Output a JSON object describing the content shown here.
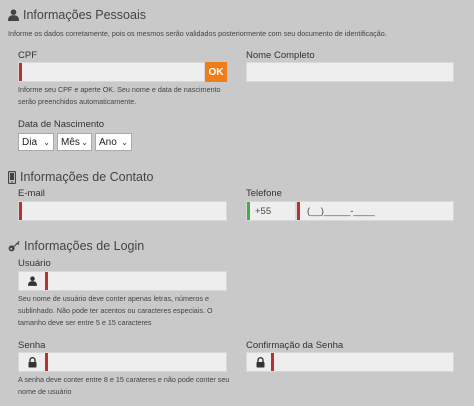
{
  "personal": {
    "title": "Informações Pessoais",
    "notice": "Informe os dados corretamente, pois os mesmos serão validados posteriormente com seu documento de identificação.",
    "cpf_label": "CPF",
    "ok_label": "OK",
    "cpf_hint": "Informe seu CPF e aperte OK. Seu nome e data de nascimento serão preenchidos automaticamente.",
    "name_label": "Nome Completo",
    "birth_label": "Data de Nascimento",
    "day_option": "Dia",
    "month_option": "Mês",
    "year_option": "Ano"
  },
  "contact": {
    "title": "Informações de Contato",
    "email_label": "E-mail",
    "phone_label": "Telefone",
    "country_code": "+55",
    "phone_mask": "(__)_____-____"
  },
  "login": {
    "title": "Informações de Login",
    "user_label": "Usuário",
    "user_hint": "Seu nome de usuário deve conter apenas letras, números e sublinhado. Não pode ter acentos ou caracteres especiais. O tamanho deve ser entre 5 e 15 caracteres",
    "password_label": "Senha",
    "confirm_label": "Confirmação da Senha",
    "password_hint": "A senha deve conter entre 8 e 15 carateres e não pode conter seu nome de usuário"
  },
  "colors": {
    "accent": "#ef7d1a",
    "required": "#b83232",
    "valid": "#3fae3f"
  }
}
